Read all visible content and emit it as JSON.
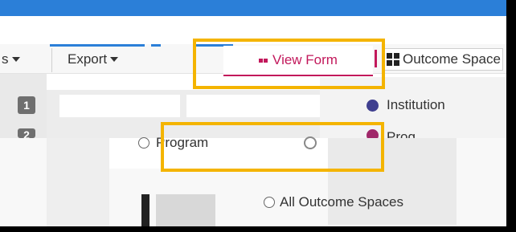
{
  "toolbar": {
    "prev_label": "s",
    "export_label": "Export",
    "view_form_label": "View Form",
    "outcome_spaces_label": "Outcome Space"
  },
  "left_rail": {
    "badges": [
      "1",
      "2"
    ]
  },
  "dropdown_list": {
    "items": [
      {
        "label": "Institution",
        "color": "#3f3f8f"
      },
      {
        "label": "Prog",
        "color": "#a0286a"
      }
    ]
  },
  "panel": {
    "program_option": "Program",
    "outcome_spaces_option": "All Outcome Spaces"
  },
  "colors": {
    "accent": "#c2185b",
    "brand_blue": "#2b7fd8",
    "highlight": "#f4b400"
  }
}
